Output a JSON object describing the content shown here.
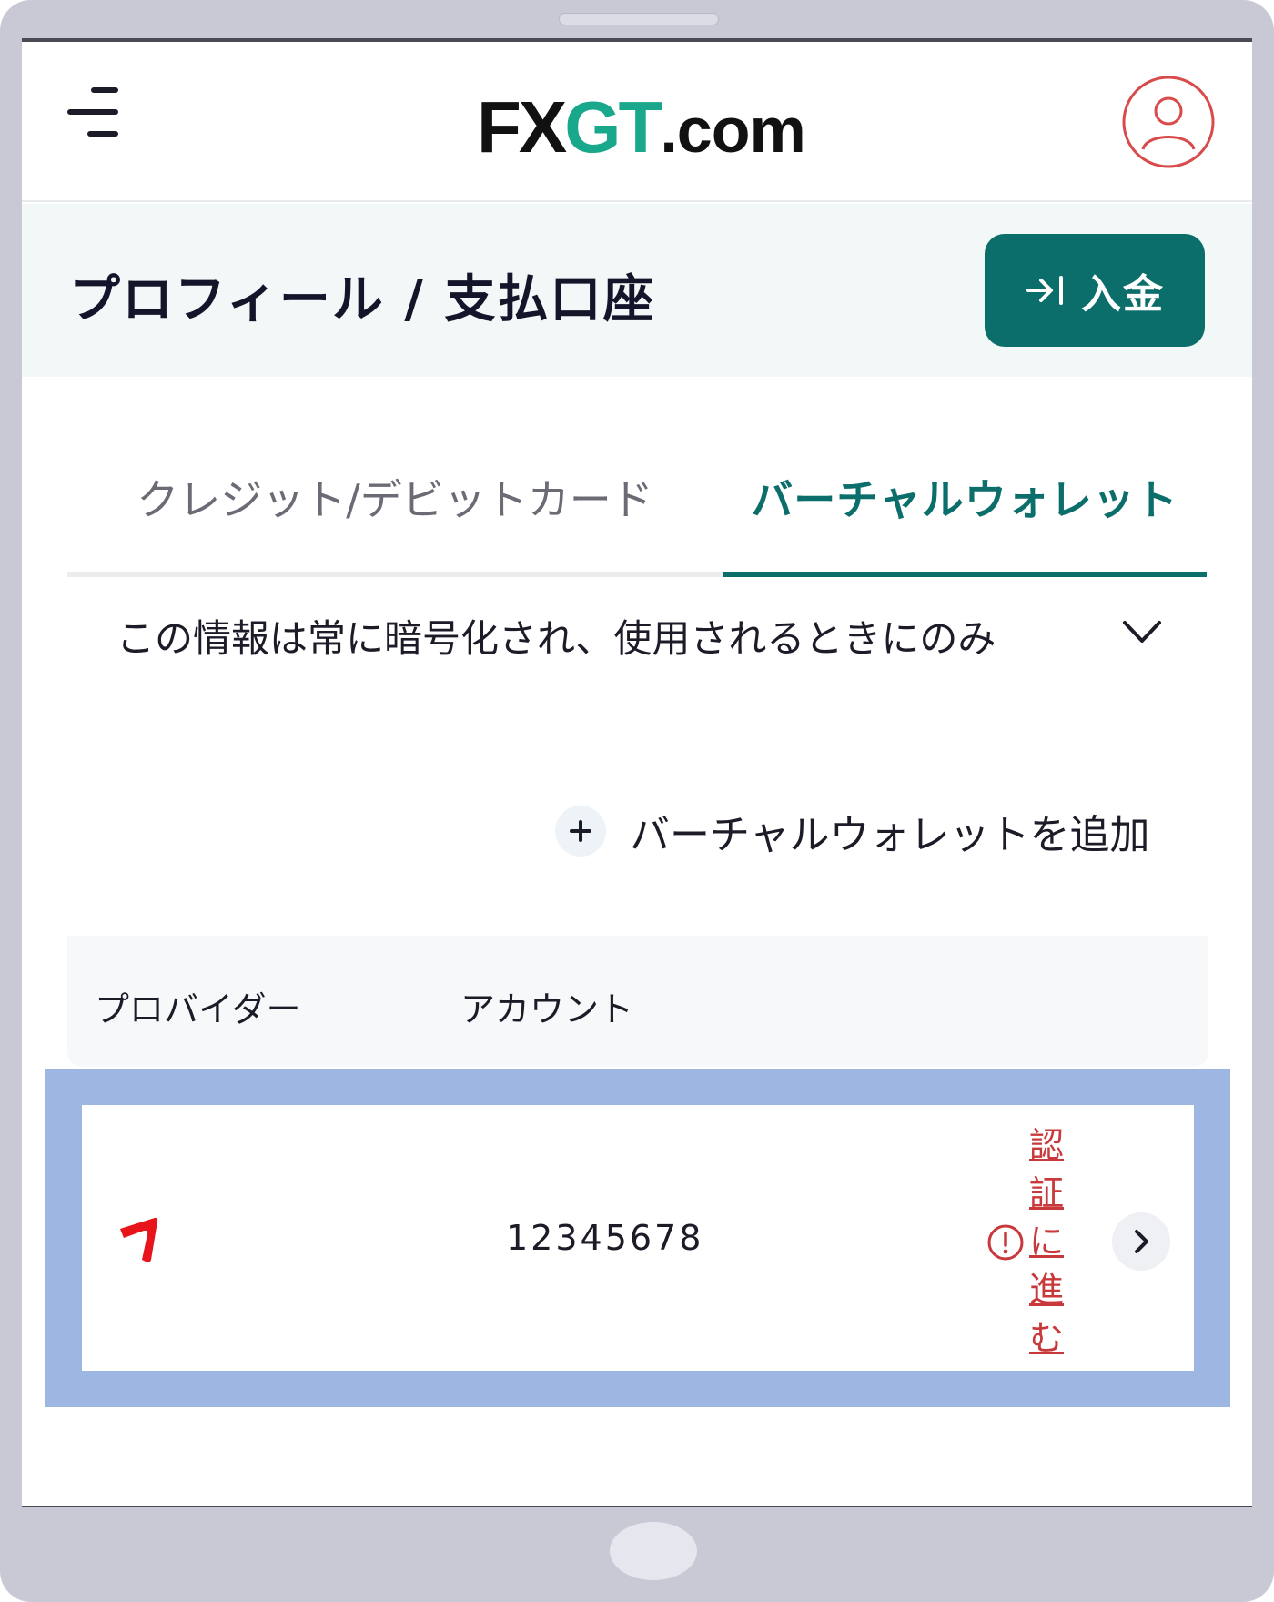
{
  "header": {
    "logo": {
      "fx": "FX",
      "gt": "GT",
      "com": ".com"
    },
    "menu_icon": "hamburger-icon",
    "profile_icon": "user-avatar-icon"
  },
  "page": {
    "title": "プロフィール / 支払口座",
    "deposit_button": {
      "label": "入金",
      "icon": "arrow-to-right-icon"
    }
  },
  "tabs": [
    {
      "label": "クレジット/デビットカード",
      "active": false
    },
    {
      "label": "バーチャルウォレット",
      "active": true
    }
  ],
  "info": {
    "text": "この情報は常に暗号化され、使用されるときにのみ",
    "icon": "chevron-down-icon"
  },
  "add_wallet": {
    "label": "バーチャルウォレットを追加",
    "icon": "plus-icon"
  },
  "table": {
    "columns": [
      "プロバイダー",
      "アカウント"
    ],
    "rows": [
      {
        "provider_icon": "provider-logo-icon",
        "account": "12345678",
        "status_link": "認証に進む",
        "status_icon": "alert-circle-icon",
        "action_icon": "chevron-right-icon"
      }
    ]
  },
  "colors": {
    "brand_teal": "#0c6e6a",
    "logo_green": "#1aa88c",
    "alert_red": "#c9383a",
    "highlight_blue": "#9db7e2"
  }
}
